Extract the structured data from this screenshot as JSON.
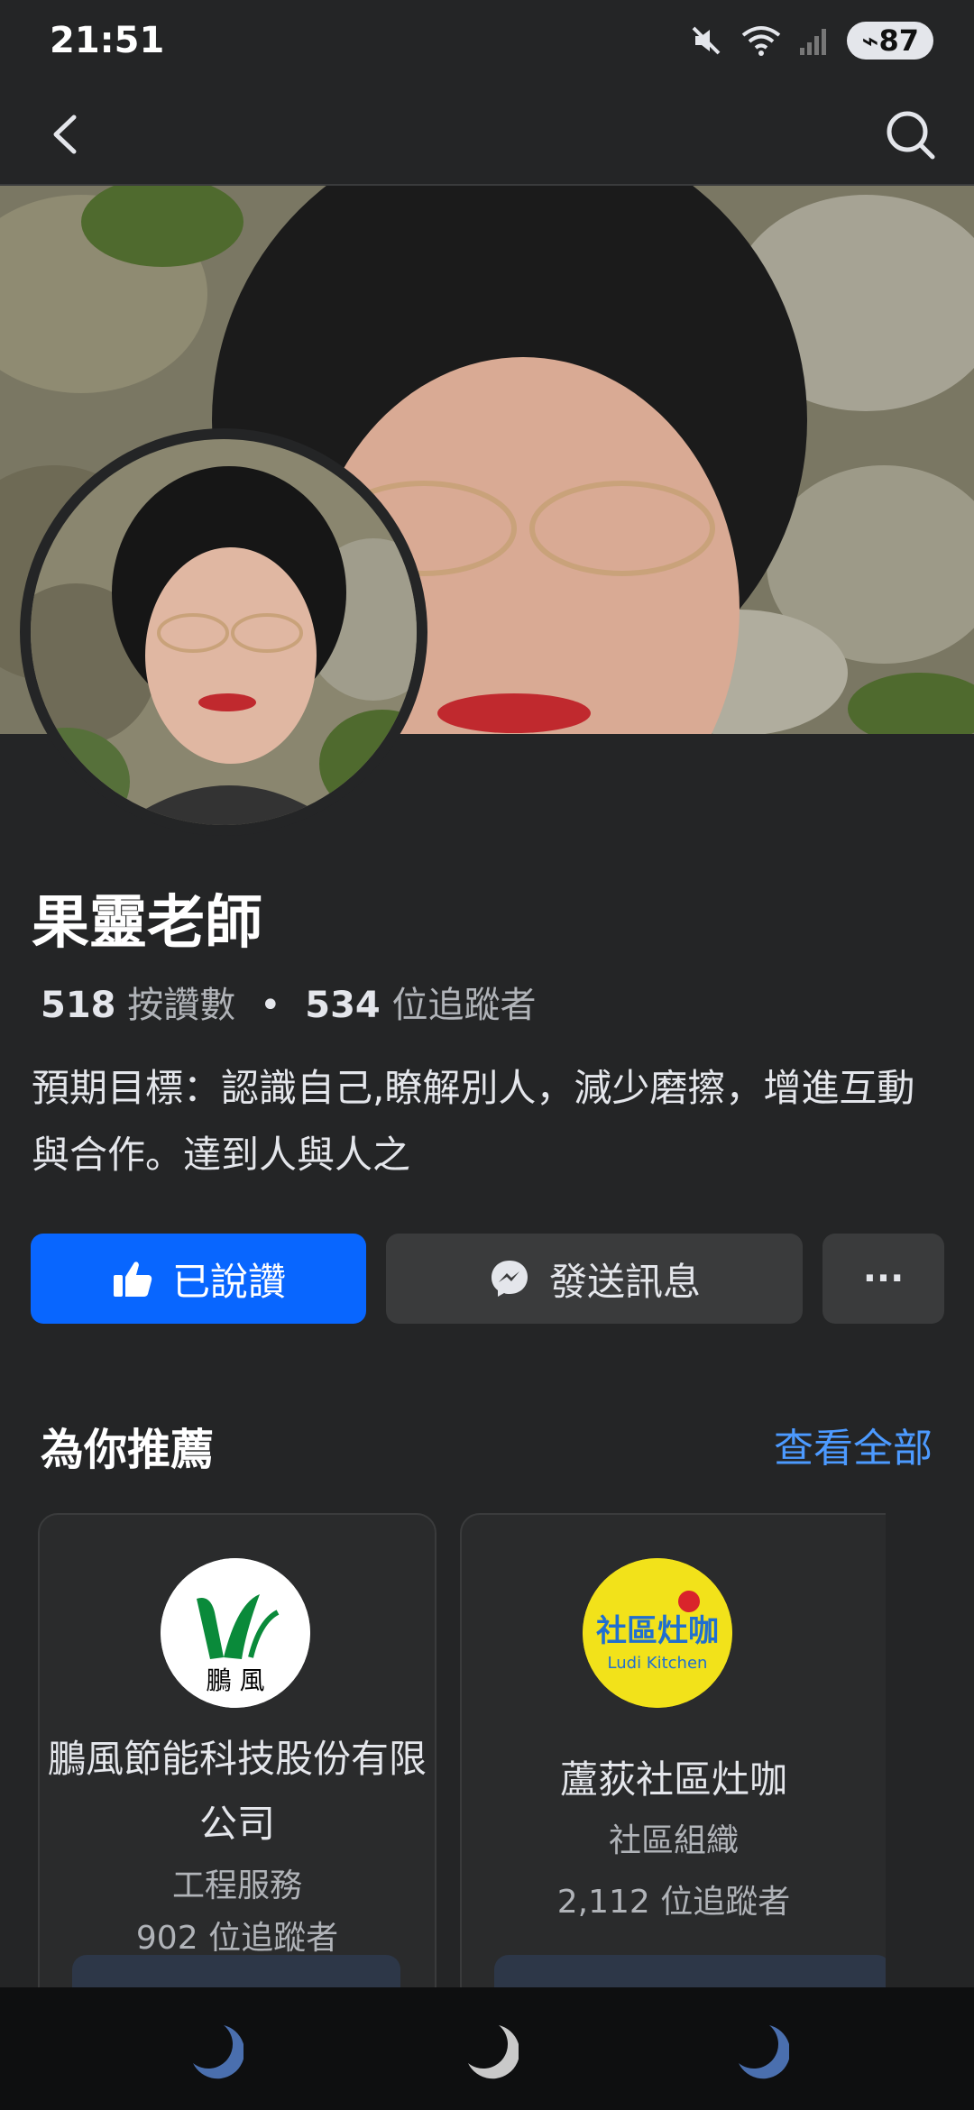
{
  "status_bar": {
    "time": "21:51",
    "battery": "87"
  },
  "header": {
    "back_icon": "chevron-left-icon",
    "search_icon": "search-icon"
  },
  "profile": {
    "name": "果靈老師",
    "likes_count": "518",
    "likes_label": "按讚數",
    "separator": "•",
    "followers_count": "534",
    "followers_label": "位追蹤者",
    "bio": "預期目標：認識自己,瞭解別人，減少磨擦，增進互動與合作。達到人與人之"
  },
  "actions": {
    "liked_label": "已說讚",
    "message_label": "發送訊息",
    "more_label": "···"
  },
  "recommend": {
    "title": "為你推薦",
    "see_all": "查看全部",
    "cards": [
      {
        "name": "鵬風節能科技股份有限公司",
        "category": "工程服務",
        "followers": "902 位追蹤者",
        "logo_text": "鵬 風"
      },
      {
        "name": "蘆荻社區灶咖",
        "category": "社區組織",
        "followers": "2,112 位追蹤者",
        "logo_text": "社區灶咖",
        "logo_sub": "Ludi Kitchen"
      }
    ]
  },
  "colors": {
    "background": "#242526",
    "accent": "#0866ff",
    "link": "#4c9aff",
    "button_dark": "#3a3b3c"
  }
}
